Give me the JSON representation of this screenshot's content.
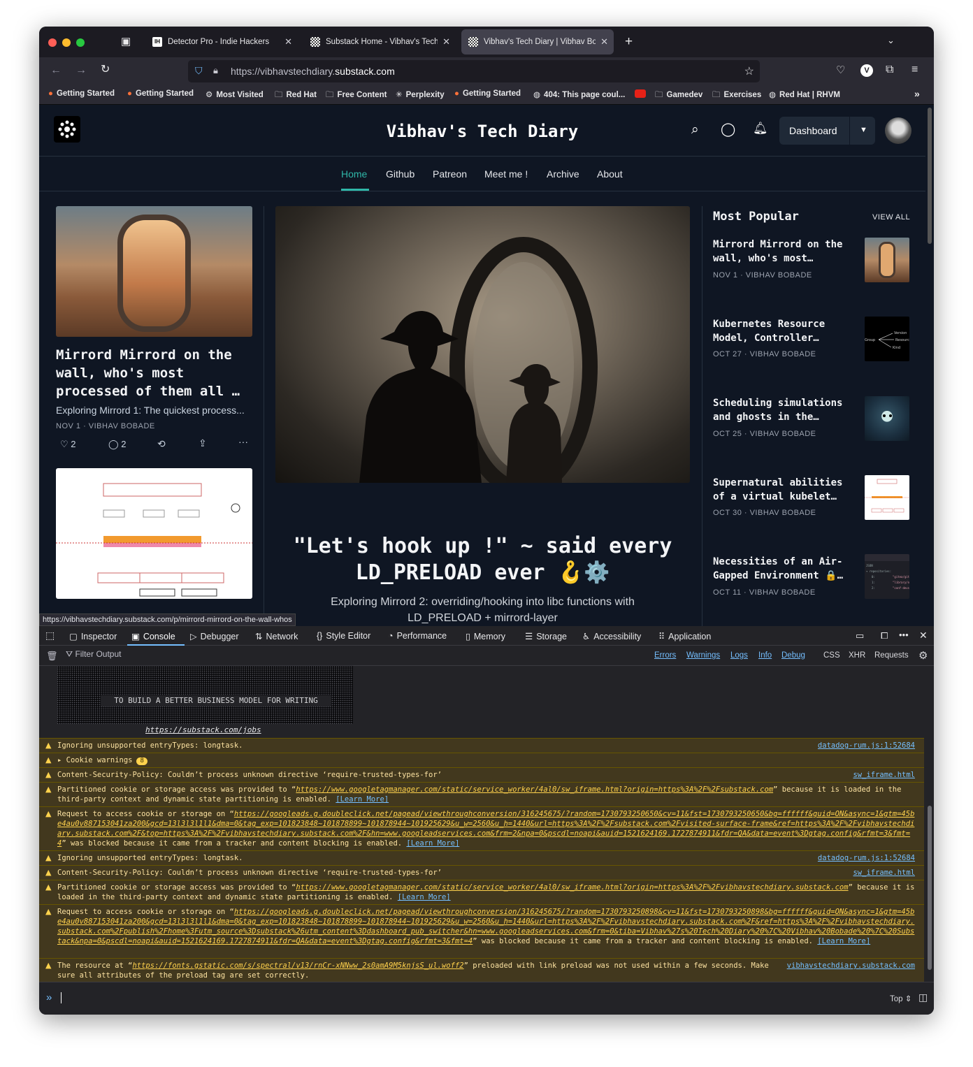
{
  "browser": {
    "tabs": [
      {
        "title": "Detector Pro - Indie Hackers",
        "favicon": "IH"
      },
      {
        "title": "Substack Home - Vibhav's Tech",
        "favicon": "substack"
      },
      {
        "title": "Vibhav's Tech Diary | Vibhav Bo",
        "favicon": "substack"
      }
    ],
    "url_prefix": "https://vibhavstechdiary.",
    "url_domain": "substack.com",
    "bookmarks": [
      {
        "label": "Getting Started",
        "icon": "firefox-icon"
      },
      {
        "label": "Getting Started",
        "icon": "firefox-icon"
      },
      {
        "label": "Most Visited",
        "icon": "gear-icon"
      },
      {
        "label": "Red Hat",
        "icon": "folder-icon"
      },
      {
        "label": "Free Content",
        "icon": "folder-icon"
      },
      {
        "label": "Perplexity",
        "icon": "perplexity-icon"
      },
      {
        "label": "Getting Started",
        "icon": "firefox-icon"
      },
      {
        "label": "404: This page coul...",
        "icon": "globe-icon"
      },
      {
        "label": "",
        "icon": "youtube-icon"
      },
      {
        "label": "Gamedev",
        "icon": "folder-icon"
      },
      {
        "label": "Exercises",
        "icon": "folder-icon"
      },
      {
        "label": "Red Hat | RHVM",
        "icon": "globe-icon"
      }
    ],
    "profile_letter": "V",
    "status_url": "https://vibhavstechdiary.substack.com/p/mirrord-mirrord-on-the-wall-whos"
  },
  "site": {
    "title": "Vibhav's Tech Diary",
    "dashboard_label": "Dashboard",
    "nav": [
      "Home",
      "Github",
      "Patreon",
      "Meet me !",
      "Archive",
      "About"
    ],
    "left_post": {
      "title": "Mirrord Mirrord on the wall, who's most processed of them all …",
      "subtitle": "Exploring Mirrord 1: The quickest process...",
      "meta": "NOV 1 · VIBHAV BOBADE",
      "likes": "2",
      "comments": "2"
    },
    "hero": {
      "title": "\"Let's hook up !\" ~ said every LD_PRELOAD ever 🪝⚙️",
      "subtitle": "Exploring Mirrord 2: overriding/hooking into libc functions with LD_PRELOAD + mirrord-layer"
    },
    "popular": {
      "heading": "Most Popular",
      "view_all": "VIEW ALL",
      "items": [
        {
          "title": "Mirrord Mirrord on the wall, who's most…",
          "meta": "NOV 1 · VIBHAV BOBADE"
        },
        {
          "title": "Kubernetes Resource Model, Controller…",
          "meta": "OCT 27 · VIBHAV BOBADE"
        },
        {
          "title": "Scheduling simulations and ghosts in the…",
          "meta": "OCT 25 · VIBHAV BOBADE"
        },
        {
          "title": "Supernatural abilities of a virtual kubelet…",
          "meta": "OCT 30 · VIBHAV BOBADE"
        },
        {
          "title": "Necessities of an Air-Gapped Environment 🔒…",
          "meta": "OCT 11 · VIBHAV BOBADE"
        }
      ]
    }
  },
  "devtools": {
    "tabs": [
      "Inspector",
      "Console",
      "Debugger",
      "Network",
      "Style Editor",
      "Performance",
      "Memory",
      "Storage",
      "Accessibility",
      "Application"
    ],
    "filter_placeholder": "Filter Output",
    "filters": [
      "Errors",
      "Warnings",
      "Logs",
      "Info",
      "Debug"
    ],
    "filters_right": [
      "CSS",
      "XHR",
      "Requests"
    ],
    "ascii_banner": "TO BUILD A BETTER BUSINESS MODEL FOR WRITING",
    "jobs_link": "https://substack.com/jobs",
    "learn_more": "[Learn More]",
    "messages": [
      {
        "text": "Ignoring unsupported entryTypes: longtask.",
        "source": "datadog-rum.js:1:52684"
      },
      {
        "text": "Cookie warnings",
        "count": "8"
      },
      {
        "text": "Content-Security-Policy: Couldn’t process unknown directive ‘require-trusted-types-for’",
        "source": "sw_iframe.html"
      },
      {
        "pre": "Partitioned cookie or storage access was provided to “",
        "link": "https://www.googletagmanager.com/static/service_worker/4al0/sw_iframe.html?origin=https%3A%2F%2Fsubstack.com",
        "post": "” because it is loaded in the third-party context and dynamic state partitioning is enabled."
      },
      {
        "pre": "Request to access cookie or storage on “",
        "link": "https://googleads.g.doubleclick.net/pagead/viewthroughconversion/316245675/?random=1730793250650&cv=11&fst=1730793250650&bg=ffffff&guid=ON&async=1&gtm=45be4au0v887153041za200&gcd=13l3l3l1l1&dma=0&tag_exp=101823848~101878899~101878944~101925629&u_w=2560&u_h=1440&url=https%3A%2F%2Fsubstack.com%2Fvisited-surface-frame&ref=https%3A%2F%2Fvibhavstechdiary.substack.com%2F&top=https%3A%2F%2Fvibhavstechdiary.substack.com%2F&hn=www.googleadservices.com&frm=2&npa=0&pscdl=noapi&auid=1521624169.1727874911&fdr=QA&data=event%3Dgtag.config&rfmt=3&fmt=4",
        "post": "” was blocked because it came from a tracker and content blocking is enabled."
      },
      {
        "text": "Ignoring unsupported entryTypes: longtask.",
        "source": "datadog-rum.js:1:52684"
      },
      {
        "text": "Content-Security-Policy: Couldn’t process unknown directive ‘require-trusted-types-for’",
        "source": "sw_iframe.html"
      },
      {
        "pre": "Partitioned cookie or storage access was provided to “",
        "link": "https://www.googletagmanager.com/static/service_worker/4al0/sw_iframe.html?origin=https%3A%2F%2Fvibhavstechdiary.substack.com",
        "post": "” because it is loaded in the third-party context and dynamic state partitioning is enabled."
      },
      {
        "pre": "Request to access cookie or storage on “",
        "link": "https://googleads.g.doubleclick.net/pagead/viewthroughconversion/316245675/?random=1730793250898&cv=11&fst=1730793250898&bg=ffffff&guid=ON&async=1&gtm=45be4au0v887153041za200&gcd=13l3l3l1l1&dma=0&tag_exp=101823848~101878899~101878944~101925629&u_w=2560&u_h=1440&url=https%3A%2F%2Fvibhavstechdiary.substack.com%2F&ref=https%3A%2F%2Fvibhavstechdiary.substack.com%2Fpublish%2Fhome%3Futm_source%3Dsubstack%26utm_content%3Ddashboard_pub_switcher&hn=www.googleadservices.com&frm=0&tiba=Vibhav%27s%20Tech%20Diary%20%7C%20Vibhav%20Bobade%20%7C%20Substack&npa=0&pscdl=noapi&auid=1521624169.1727874911&fdr=QA&data=event%3Dgtag.config&rfmt=3&fmt=4",
        "post": "” was blocked because it came from a tracker and content blocking is enabled."
      },
      {
        "pre": "The resource at “",
        "link": "https://fonts.gstatic.com/s/spectral/v13/rnCr-xNNww_2s0amA9M5knjsS_ul.woff2",
        "post": "” preloaded with link preload was not used within a few seconds. Make sure all attributes of the preload tag are set correctly.",
        "source": "vibhavstechdiary.substack.com"
      }
    ],
    "context_selector": "Top"
  },
  "colors": {
    "accent": "#2fb7a8",
    "page_bg": "#0f1623",
    "warning_bg": "#42381e",
    "warning_text": "#fce2a1"
  }
}
